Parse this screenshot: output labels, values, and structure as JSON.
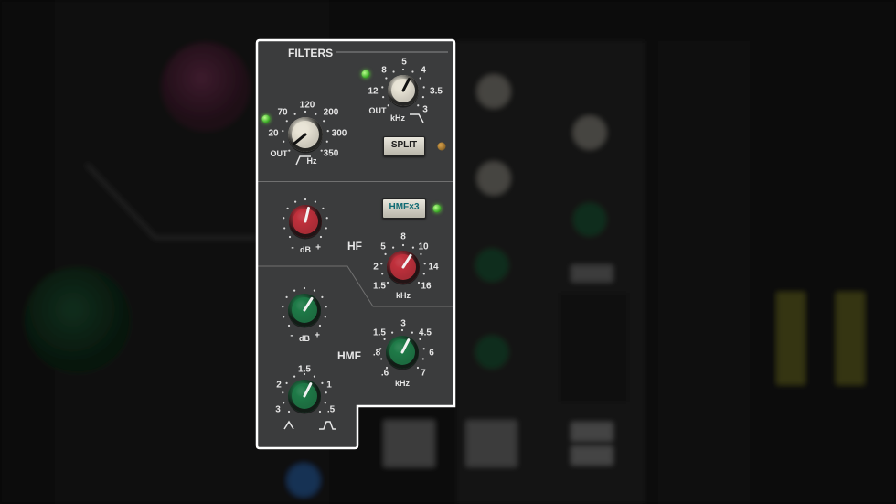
{
  "filters": {
    "title": "FILTERS",
    "lowcut": {
      "ticks": [
        "20",
        "70",
        "120",
        "200",
        "300",
        "350"
      ],
      "out_label": "OUT",
      "unit": "Hz",
      "value_fraction": 0.02
    },
    "highcut": {
      "ticks": [
        "12",
        "8",
        "5",
        "4",
        "3.5",
        "3"
      ],
      "out_label": "OUT",
      "unit": "kHz",
      "value_fraction": 0.6
    },
    "split_button": "SPLIT"
  },
  "hf": {
    "label": "HF",
    "button": "HMF×3",
    "gain": {
      "minus": "-",
      "unit": "dB",
      "plus": "+",
      "value_fraction": 0.55
    },
    "freq": {
      "ticks": [
        "1.5",
        "2",
        "5",
        "8",
        "10",
        "14",
        "16"
      ],
      "unit": "kHz",
      "value_fraction": 0.62
    }
  },
  "hmf": {
    "label": "HMF",
    "gain": {
      "minus": "-",
      "unit": "dB",
      "plus": "+",
      "value_fraction": 0.62
    },
    "freq": {
      "ticks": [
        ".6",
        ".8",
        "1.5",
        "3",
        "4.5",
        "6",
        "7"
      ],
      "unit": "kHz",
      "value_fraction": 0.6
    },
    "q": {
      "ticks": [
        "3",
        "2",
        "1.5",
        "1",
        ".5"
      ],
      "value_fraction": 0.6
    }
  },
  "colors": {
    "panel": "#3b3c3d",
    "red_knob": "#c0303c",
    "green_knob": "#1f7a48",
    "cream_knob": "#e7e3d5",
    "highlight": "#ffffff"
  }
}
